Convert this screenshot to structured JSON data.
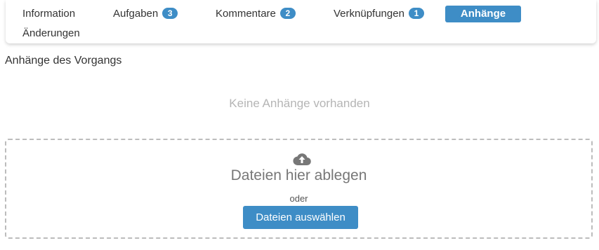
{
  "tabs": [
    {
      "label": "Information",
      "badge": null
    },
    {
      "label": "Aufgaben",
      "badge": "3"
    },
    {
      "label": "Kommentare",
      "badge": "2"
    },
    {
      "label": "Verknüpfungen",
      "badge": "1"
    },
    {
      "label": "Anhänge",
      "badge": null,
      "active": true
    },
    {
      "label": "Änderungen",
      "badge": null
    }
  ],
  "section": {
    "title": "Anhänge des Vorgangs"
  },
  "empty_message": "Keine Anhänge vorhanden",
  "dropzone": {
    "icon": "cloud-upload-icon",
    "title": "Dateien hier ablegen",
    "or_text": "oder",
    "button_label": "Dateien auswählen"
  },
  "colors": {
    "accent": "#3e8dc6",
    "muted_text": "#b5b5b5",
    "dropzone_border": "#bcbcbc"
  }
}
